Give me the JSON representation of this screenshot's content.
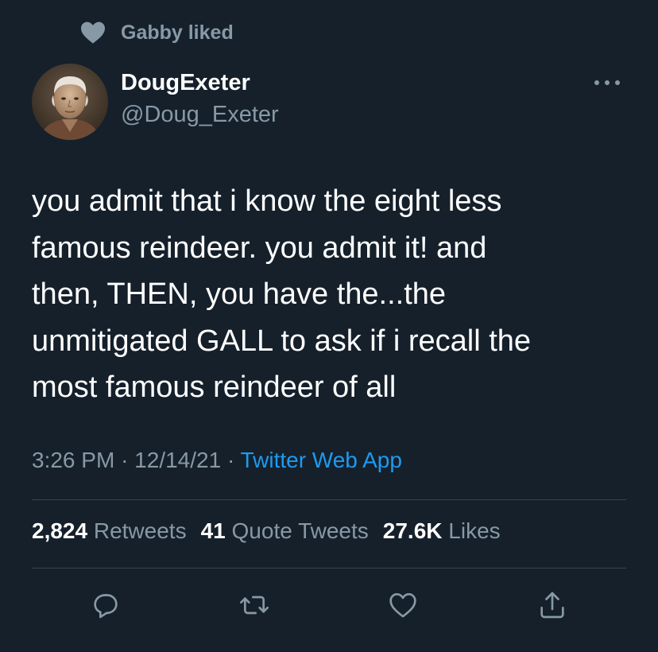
{
  "social_context": {
    "text": "Gabby liked",
    "icon": "heart-icon"
  },
  "author": {
    "name": "DougExeter",
    "handle": "@Doug_Exeter",
    "avatar_icon": "avatar-portrait"
  },
  "tweet": {
    "text": "you admit that i know the eight less\nfamous reindeer. you admit it! and\nthen, THEN, you have the...the\nunmitigated GALL to ask if i recall the\nmost famous reindeer of all",
    "time": "3:26 PM",
    "date": "12/14/21",
    "separator": "·",
    "source": "Twitter Web App"
  },
  "stats": {
    "retweets_count": "2,824",
    "retweets_label": "Retweets",
    "quotes_count": "41",
    "quotes_label": "Quote Tweets",
    "likes_count": "27.6K",
    "likes_label": "Likes"
  },
  "actions": [
    "reply-icon",
    "retweet-icon",
    "like-icon",
    "share-icon"
  ],
  "colors": {
    "background": "#15202b",
    "secondary_text": "#8899a6",
    "link": "#1d9bf0",
    "divider": "#38444d"
  }
}
